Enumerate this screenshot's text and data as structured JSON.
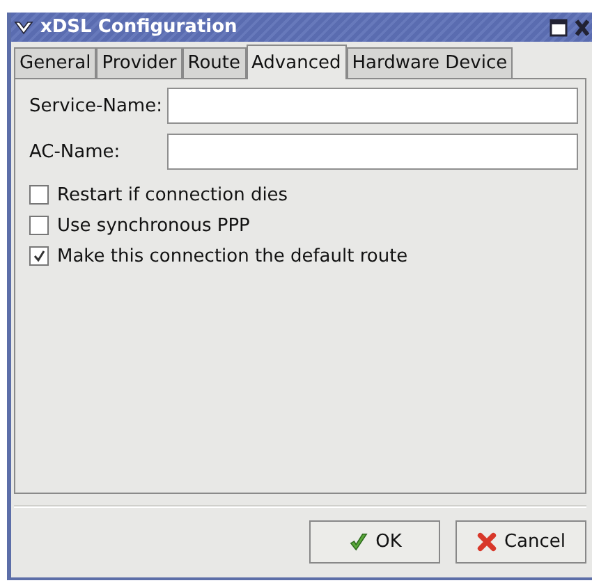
{
  "window": {
    "title": "xDSL Configuration"
  },
  "tabs": [
    {
      "label": "General",
      "selected": false
    },
    {
      "label": "Provider",
      "selected": false
    },
    {
      "label": "Route",
      "selected": false
    },
    {
      "label": "Advanced",
      "selected": true
    },
    {
      "label": "Hardware Device",
      "selected": false
    }
  ],
  "fields": [
    {
      "label": "Service-Name:"
    },
    {
      "label": "AC-Name:"
    }
  ],
  "options": [
    {
      "label": "Restart if connection dies",
      "checked": false
    },
    {
      "label": "Use synchronous PPP",
      "checked": false
    },
    {
      "label": "Make this connection the default route",
      "checked": true
    }
  ],
  "buttons": [
    {
      "kind": "ok",
      "label": "OK"
    },
    {
      "kind": "cancel",
      "label": "Cancel"
    }
  ]
}
